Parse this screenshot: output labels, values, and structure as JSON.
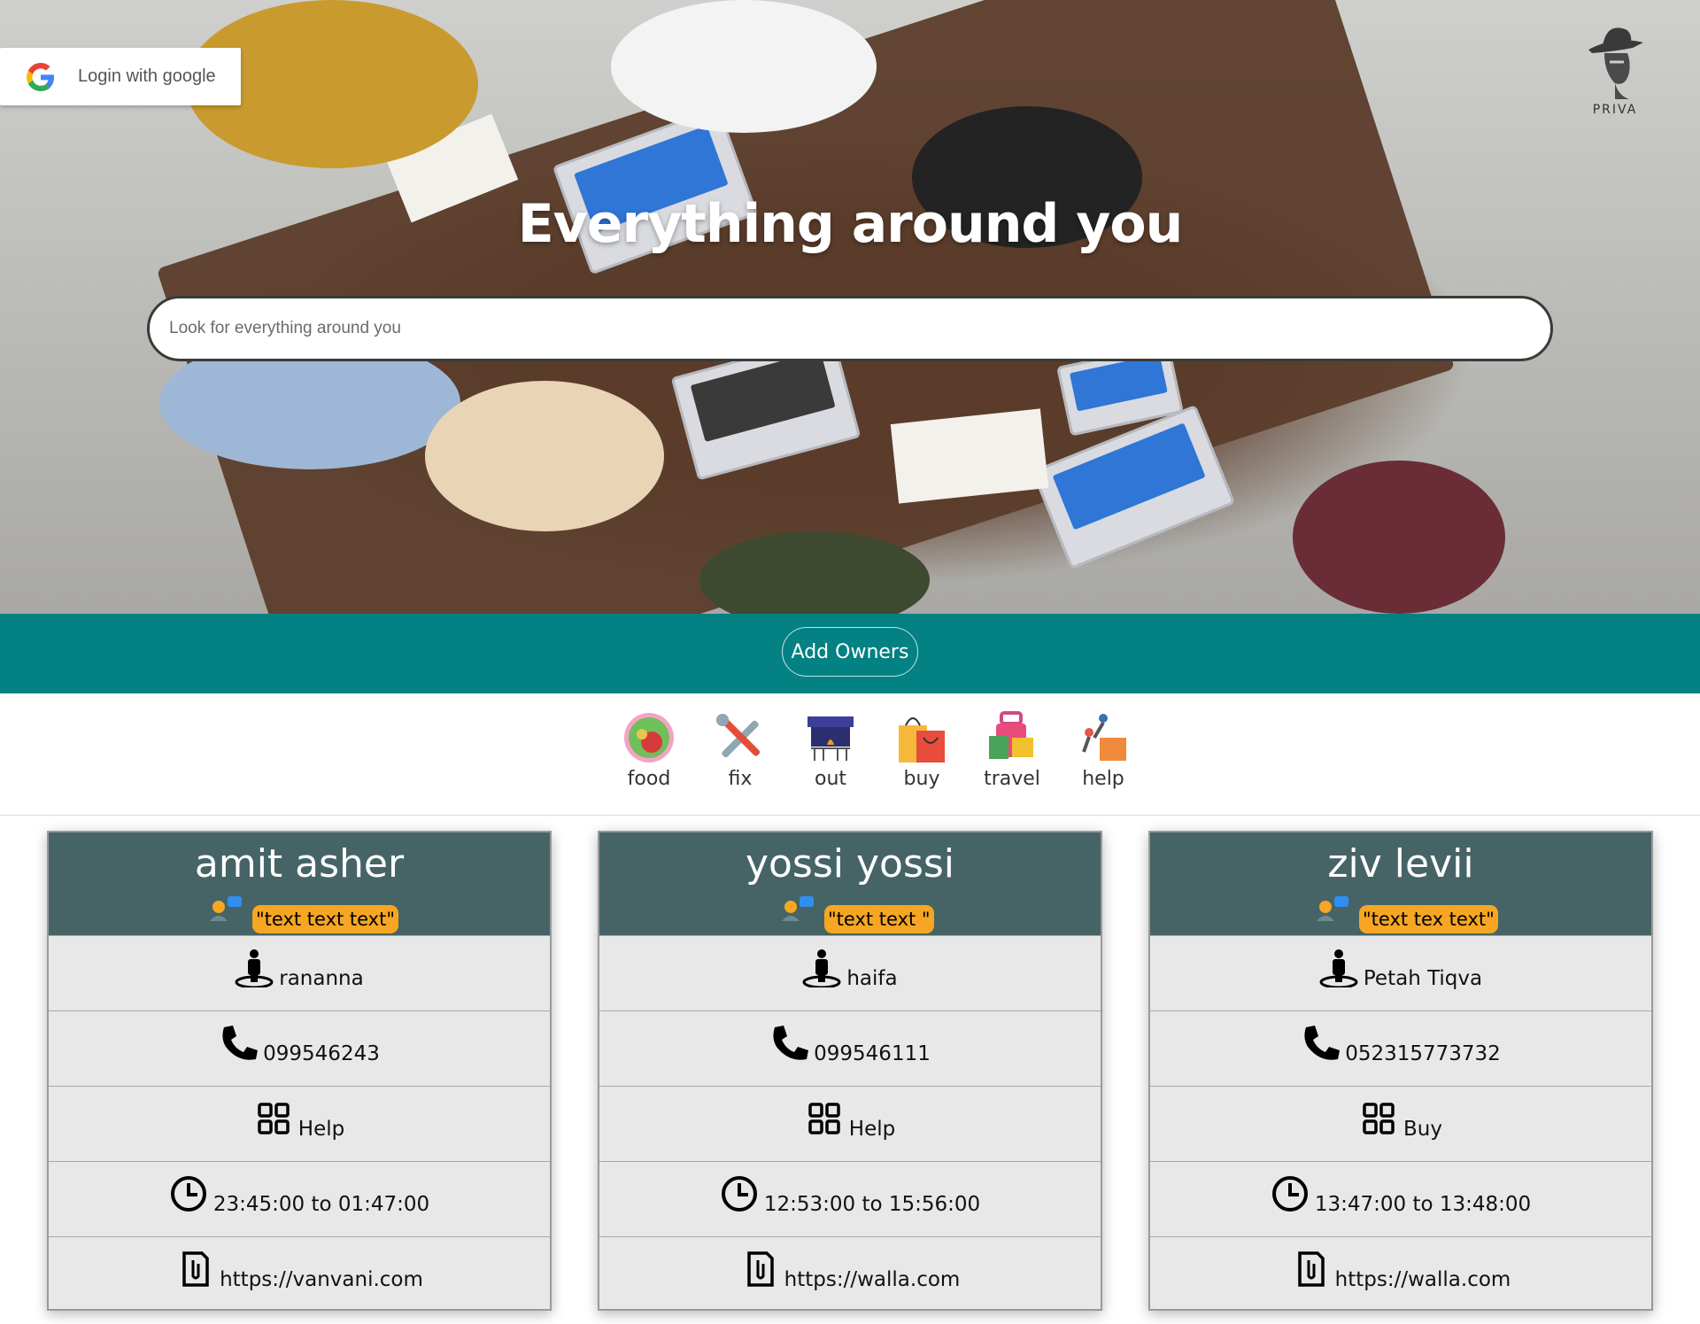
{
  "hero": {
    "title": "Everything around you",
    "search_placeholder": "Look for everything around you"
  },
  "login": {
    "label": "Login with google"
  },
  "logo": {
    "text": "PRIVA"
  },
  "add_owners_label": "Add Owners",
  "categories": [
    {
      "label": "food",
      "icon": "food-icon"
    },
    {
      "label": "fix",
      "icon": "tools-icon"
    },
    {
      "label": "out",
      "icon": "fireplace-icon"
    },
    {
      "label": "buy",
      "icon": "shopping-bag-icon"
    },
    {
      "label": "travel",
      "icon": "luggage-icon"
    },
    {
      "label": "help",
      "icon": "helping-hand-icon"
    }
  ],
  "cards": [
    {
      "name": "amit asher",
      "tag": "\"text text text\"",
      "location": "rananna",
      "phone": "099546243",
      "category": "Help",
      "hours": "23:45:00 to 01:47:00",
      "link": "https://vanvani.com"
    },
    {
      "name": "yossi yossi",
      "tag": "\"text text \"",
      "location": "haifa",
      "phone": "099546111",
      "category": "Help",
      "hours": "12:53:00 to 15:56:00",
      "link": "https://walla.com"
    },
    {
      "name": "ziv levii",
      "tag": "\"text tex text\"",
      "location": "Petah Tiqva",
      "phone": "052315773732",
      "category": "Buy",
      "hours": "13:47:00 to 13:48:00",
      "link": "https://walla.com"
    }
  ],
  "colors": {
    "teal_bar": "#048182",
    "card_header": "#466466",
    "tag": "#f6a623"
  }
}
